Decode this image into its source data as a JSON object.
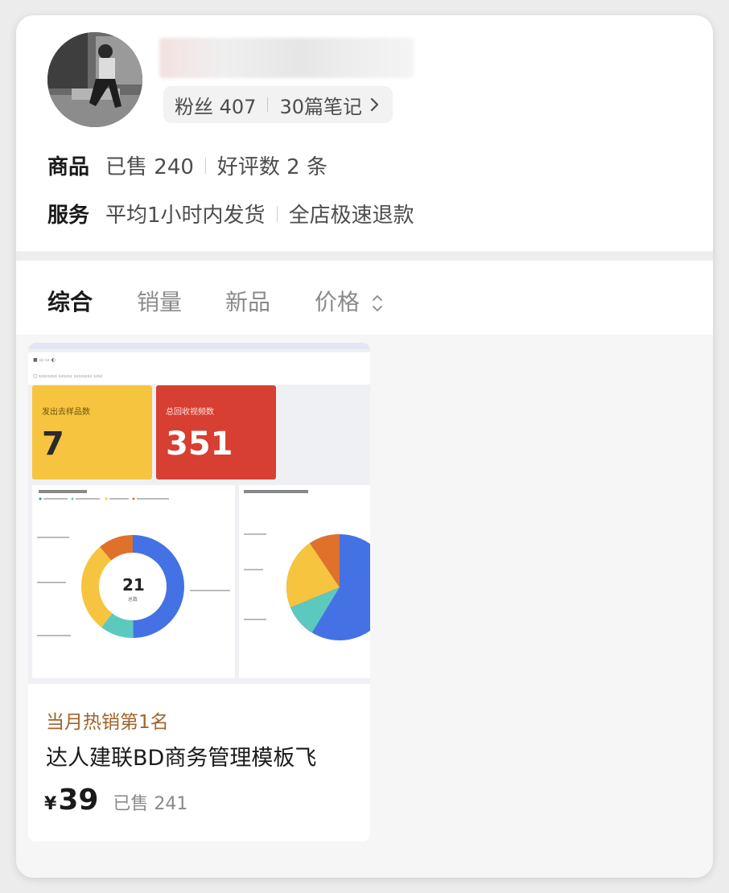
{
  "profile": {
    "fans": "粉丝 407",
    "notes": "30篇笔记"
  },
  "goods": {
    "label": "商品",
    "sold": "已售 240",
    "reviews": "好评数 2 条"
  },
  "service": {
    "label": "服务",
    "shipping": "平均1小时内发货",
    "refund": "全店极速退款"
  },
  "sort_tabs": [
    {
      "label": "综合",
      "active": true
    },
    {
      "label": "销量",
      "active": false
    },
    {
      "label": "新品",
      "active": false
    },
    {
      "label": "价格",
      "active": false
    }
  ],
  "product": {
    "thumbnail": {
      "kpi_left_label": "发出去样品数",
      "kpi_left_value": "7",
      "kpi_right_label": "总回收视频数",
      "kpi_right_value": "351",
      "donut_center_value": "21",
      "donut_center_label": "总数",
      "colors": {
        "yellow": "#f6c43f",
        "red": "#d63f31",
        "blue": "#4472e4",
        "teal": "#5cc9bf",
        "orange": "#e0712b"
      }
    },
    "rank": "当月热销第1名",
    "title": "达人建联BD商务管理模板飞",
    "currency": "¥",
    "price": "39",
    "sold": "已售 241"
  }
}
